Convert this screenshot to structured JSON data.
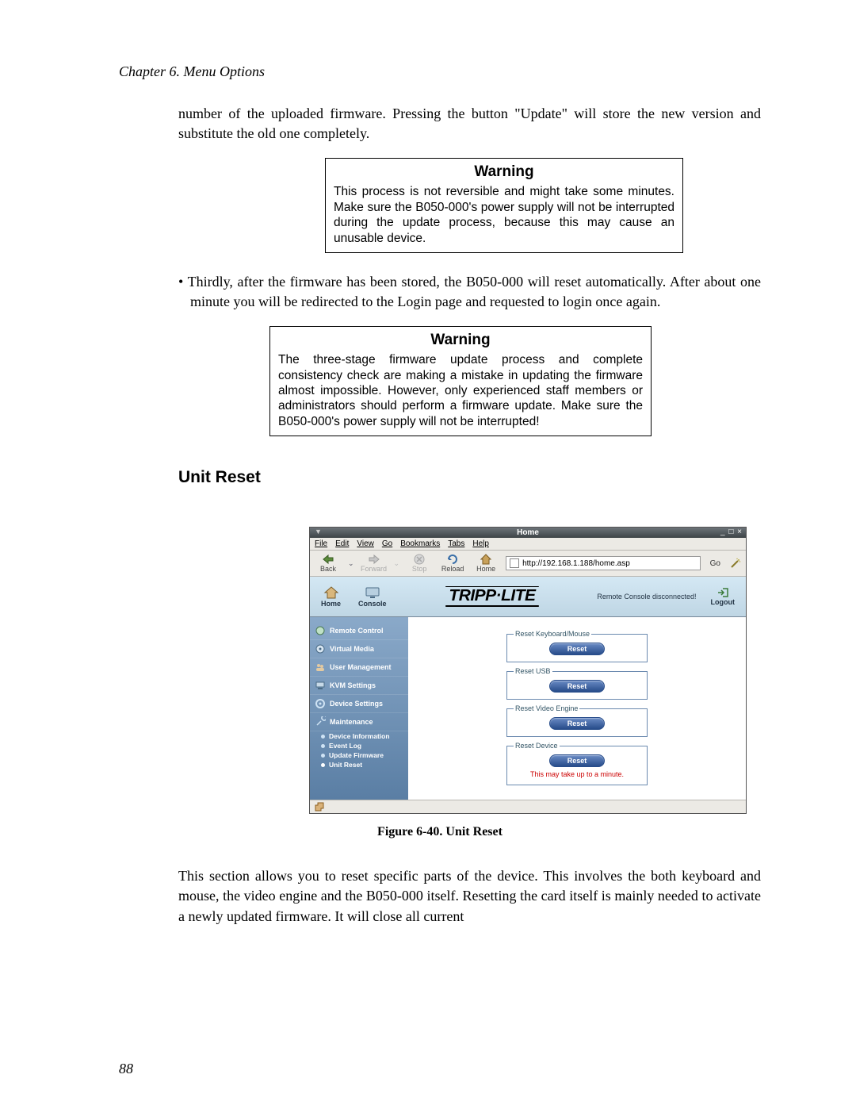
{
  "chapter": "Chapter 6. Menu Options",
  "page_number": "88",
  "intro": "number of the uploaded firmware. Pressing the button \"Update\" will store the new version and substitute the old one completely.",
  "warning1": {
    "title": "Warning",
    "body": "This process is not reversible and might take some minutes. Make sure the B050-000's power supply will not be interrupted during the update process, because this may cause an unusable device."
  },
  "bullet1": "Thirdly, after the firmware has been stored, the B050-000 will reset automatically. After about one minute you will be redirected to the Login page and requested to login once again.",
  "warning2": {
    "title": "Warning",
    "body": "The three-stage firmware update process and complete consistency check are making a mistake in updating the firmware almost impossible. However, only experienced staff members or administrators should perform a firmware update. Make sure the B050-000's power supply will not be interrupted!"
  },
  "section_heading": "Unit Reset",
  "figure_caption": "Figure 6-40. Unit Reset",
  "outro": "This section allows you to reset specific parts of the device. This involves the both keyboard and mouse, the video engine and the B050-000 itself. Resetting the card itself is mainly needed to activate a newly updated firmware. It will close all current",
  "screenshot": {
    "window_title": "Home",
    "window_controls": "_ □ ×",
    "window_menu": "▼",
    "menubar": [
      "File",
      "Edit",
      "View",
      "Go",
      "Bookmarks",
      "Tabs",
      "Help"
    ],
    "toolbar": {
      "back": "Back",
      "forward": "Forward",
      "stop": "Stop",
      "reload": "Reload",
      "home": "Home",
      "url": "http://192.168.1.188/home.asp",
      "go": "Go"
    },
    "app_header": {
      "home": "Home",
      "console": "Console",
      "logo": "TRIPP·LITE",
      "status": "Remote Console disconnected!",
      "logout": "Logout"
    },
    "sidebar": {
      "remote_control": "Remote Control",
      "virtual_media": "Virtual Media",
      "user_management": "User Management",
      "kvm_settings": "KVM Settings",
      "device_settings": "Device Settings",
      "maintenance": "Maintenance",
      "sub": {
        "device_info": "Device Information",
        "event_log": "Event Log",
        "update_fw": "Update Firmware",
        "unit_reset": "Unit Reset"
      }
    },
    "main": {
      "group1": {
        "legend": "Reset Keyboard/Mouse",
        "button": "Reset"
      },
      "group2": {
        "legend": "Reset USB",
        "button": "Reset"
      },
      "group3": {
        "legend": "Reset Video Engine",
        "button": "Reset"
      },
      "group4": {
        "legend": "Reset Device",
        "button": "Reset",
        "note": "This may take up to a minute."
      }
    }
  }
}
